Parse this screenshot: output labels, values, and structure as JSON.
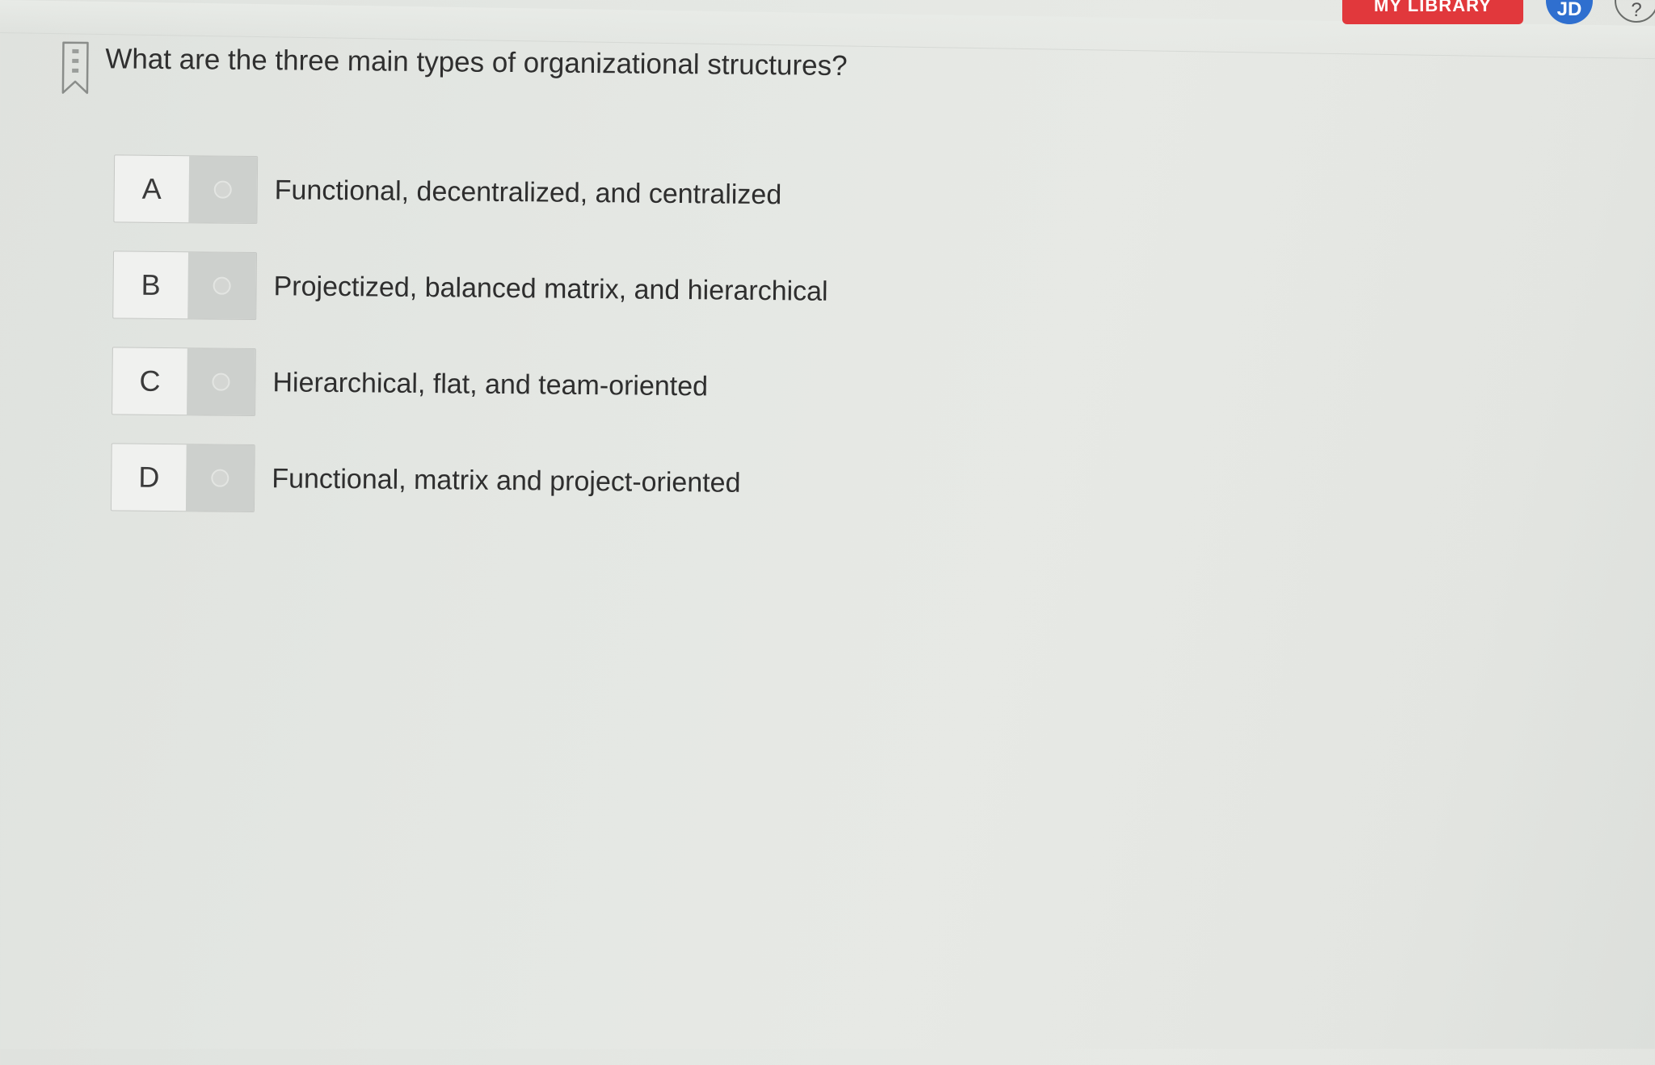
{
  "header": {
    "library_label": "MY LIBRARY",
    "avatar_initials": "JD",
    "help_label": "?"
  },
  "question": {
    "text": "What are the three main types of organizational structures?"
  },
  "options": [
    {
      "letter": "A",
      "text": "Functional, decentralized, and centralized"
    },
    {
      "letter": "B",
      "text": "Projectized, balanced matrix, and hierarchical"
    },
    {
      "letter": "C",
      "text": "Hierarchical, flat, and team-oriented"
    },
    {
      "letter": "D",
      "text": "Functional, matrix and project-oriented"
    }
  ],
  "colors": {
    "library_button": "#e1383c",
    "avatar": "#2f6fcf",
    "radio_cell": "#cdd0cd"
  },
  "icons": {
    "bookmark": "bookmark-icon",
    "radio": "radio-circle"
  }
}
